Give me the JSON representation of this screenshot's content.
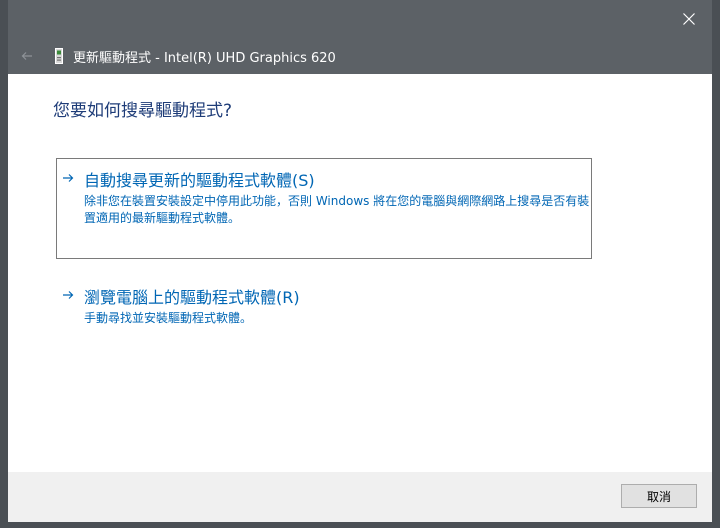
{
  "header": {
    "title": "更新驅動程式 - Intel(R) UHD Graphics 620"
  },
  "main": {
    "heading": "您要如何搜尋驅動程式?",
    "options": [
      {
        "title": "自動搜尋更新的驅動程式軟體(S)",
        "description": "除非您在裝置安裝設定中停用此功能，否則 Windows 將在您的電腦與網際網路上搜尋是否有裝置適用的最新驅動程式軟體。"
      },
      {
        "title": "瀏覽電腦上的驅動程式軟體(R)",
        "description": "手動尋找並安裝驅動程式軟體。"
      }
    ]
  },
  "footer": {
    "cancel_label": "取消"
  },
  "colors": {
    "accent": "#0066b4",
    "heading": "#1e3c78",
    "chrome": "#5c6166"
  },
  "icons": [
    "close-icon",
    "back-arrow-icon",
    "device-icon",
    "arrow-right-icon"
  ]
}
